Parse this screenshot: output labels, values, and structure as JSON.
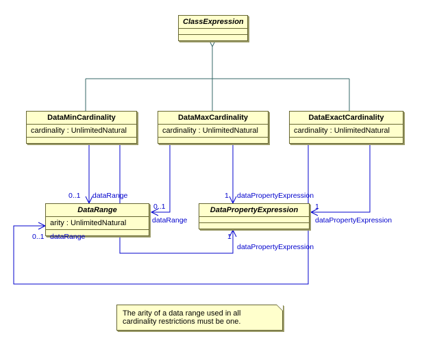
{
  "classes": {
    "classExpression": {
      "name": "ClassExpression"
    },
    "dataMinCardinality": {
      "name": "DataMinCardinality",
      "attr": "cardinality : UnlimitedNatural"
    },
    "dataMaxCardinality": {
      "name": "DataMaxCardinality",
      "attr": "cardinality : UnlimitedNatural"
    },
    "dataExactCardinality": {
      "name": "DataExactCardinality",
      "attr": "cardinality : UnlimitedNatural"
    },
    "dataRange": {
      "name": "DataRange",
      "attr": "arity : UnlimitedNatural"
    },
    "dataPropertyExpression": {
      "name": "DataPropertyExpression"
    }
  },
  "associations": {
    "minRange": {
      "mult": "0..1",
      "role": "dataRange"
    },
    "maxRange": {
      "mult": "0..1",
      "role": "dataRange"
    },
    "exactRange": {
      "mult": "0..1",
      "role": "dataRange"
    },
    "minProp": {
      "mult": "1",
      "role": "dataPropertyExpression"
    },
    "maxProp": {
      "mult": "1",
      "role": "dataPropertyExpression"
    },
    "exactProp": {
      "mult": "1",
      "role": "dataPropertyExpression"
    }
  },
  "note": {
    "line1": "The arity of a data range used in all",
    "line2": "cardinality restrictions must be one."
  }
}
